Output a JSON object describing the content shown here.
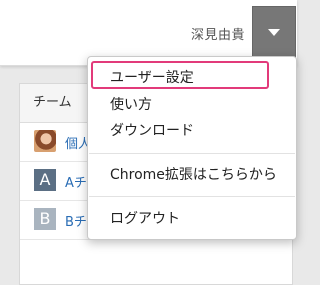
{
  "header": {
    "username": "深見由貴",
    "menu_icon": "chevron-down-icon"
  },
  "team_panel": {
    "heading": "チーム",
    "teams": [
      {
        "name": "個人",
        "icon": "user-avatar"
      },
      {
        "name": "Aチーム",
        "icon_letter": "A"
      },
      {
        "name": "Bチーム",
        "icon_letter": "B"
      }
    ]
  },
  "dropdown": {
    "items": [
      {
        "label": "ユーザー設定"
      },
      {
        "label": "使い方"
      },
      {
        "label": "ダウンロード"
      },
      {
        "label": "Chrome拡張はこちらから"
      },
      {
        "label": "ログアウト"
      }
    ],
    "highlight_color": "#e23a7a"
  },
  "colors": {
    "link": "#2a6db5",
    "toggle_bg": "#777777"
  }
}
